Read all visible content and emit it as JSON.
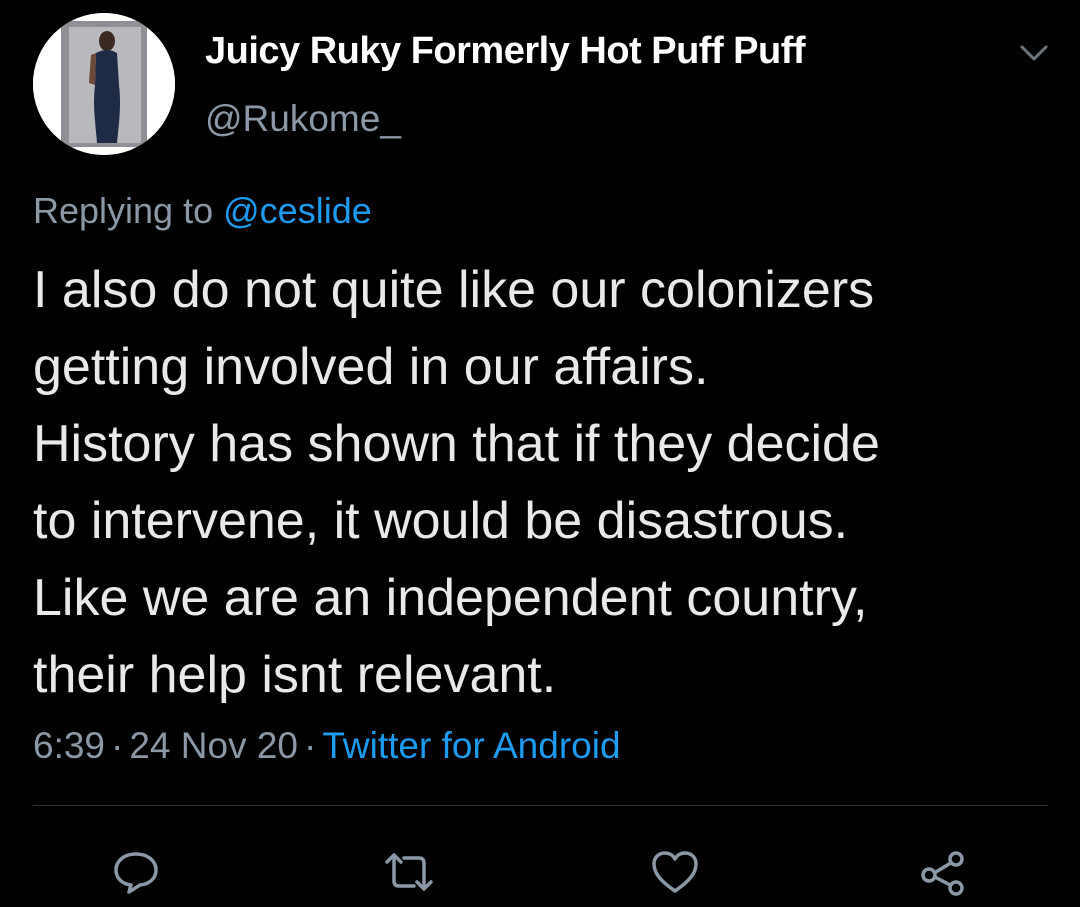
{
  "tweet": {
    "display_name": "Juicy Ruky Formerly Hot Puff Puff",
    "handle": "@Rukome_",
    "replying_prefix": "Replying to",
    "replying_to": "@ceslide",
    "text_lines": [
      "I also do not quite like our colonizers",
      "getting involved in our affairs.",
      "History has shown that if they decide",
      "to intervene, it would be disastrous.",
      "Like we are an independent country,",
      "their help isnt relevant."
    ],
    "time": "6:39",
    "separator": "·",
    "date": "24 Nov 20",
    "source": "Twitter for Android"
  },
  "icons": {
    "menu": "chevron-down-icon",
    "reply": "reply-icon",
    "retweet": "retweet-icon",
    "like": "like-icon",
    "share": "share-icon"
  },
  "colors": {
    "background": "#000000",
    "text": "#e7e9ea",
    "secondary": "#8b98a5",
    "link": "#1d9bf0",
    "divider": "#2f3336"
  }
}
